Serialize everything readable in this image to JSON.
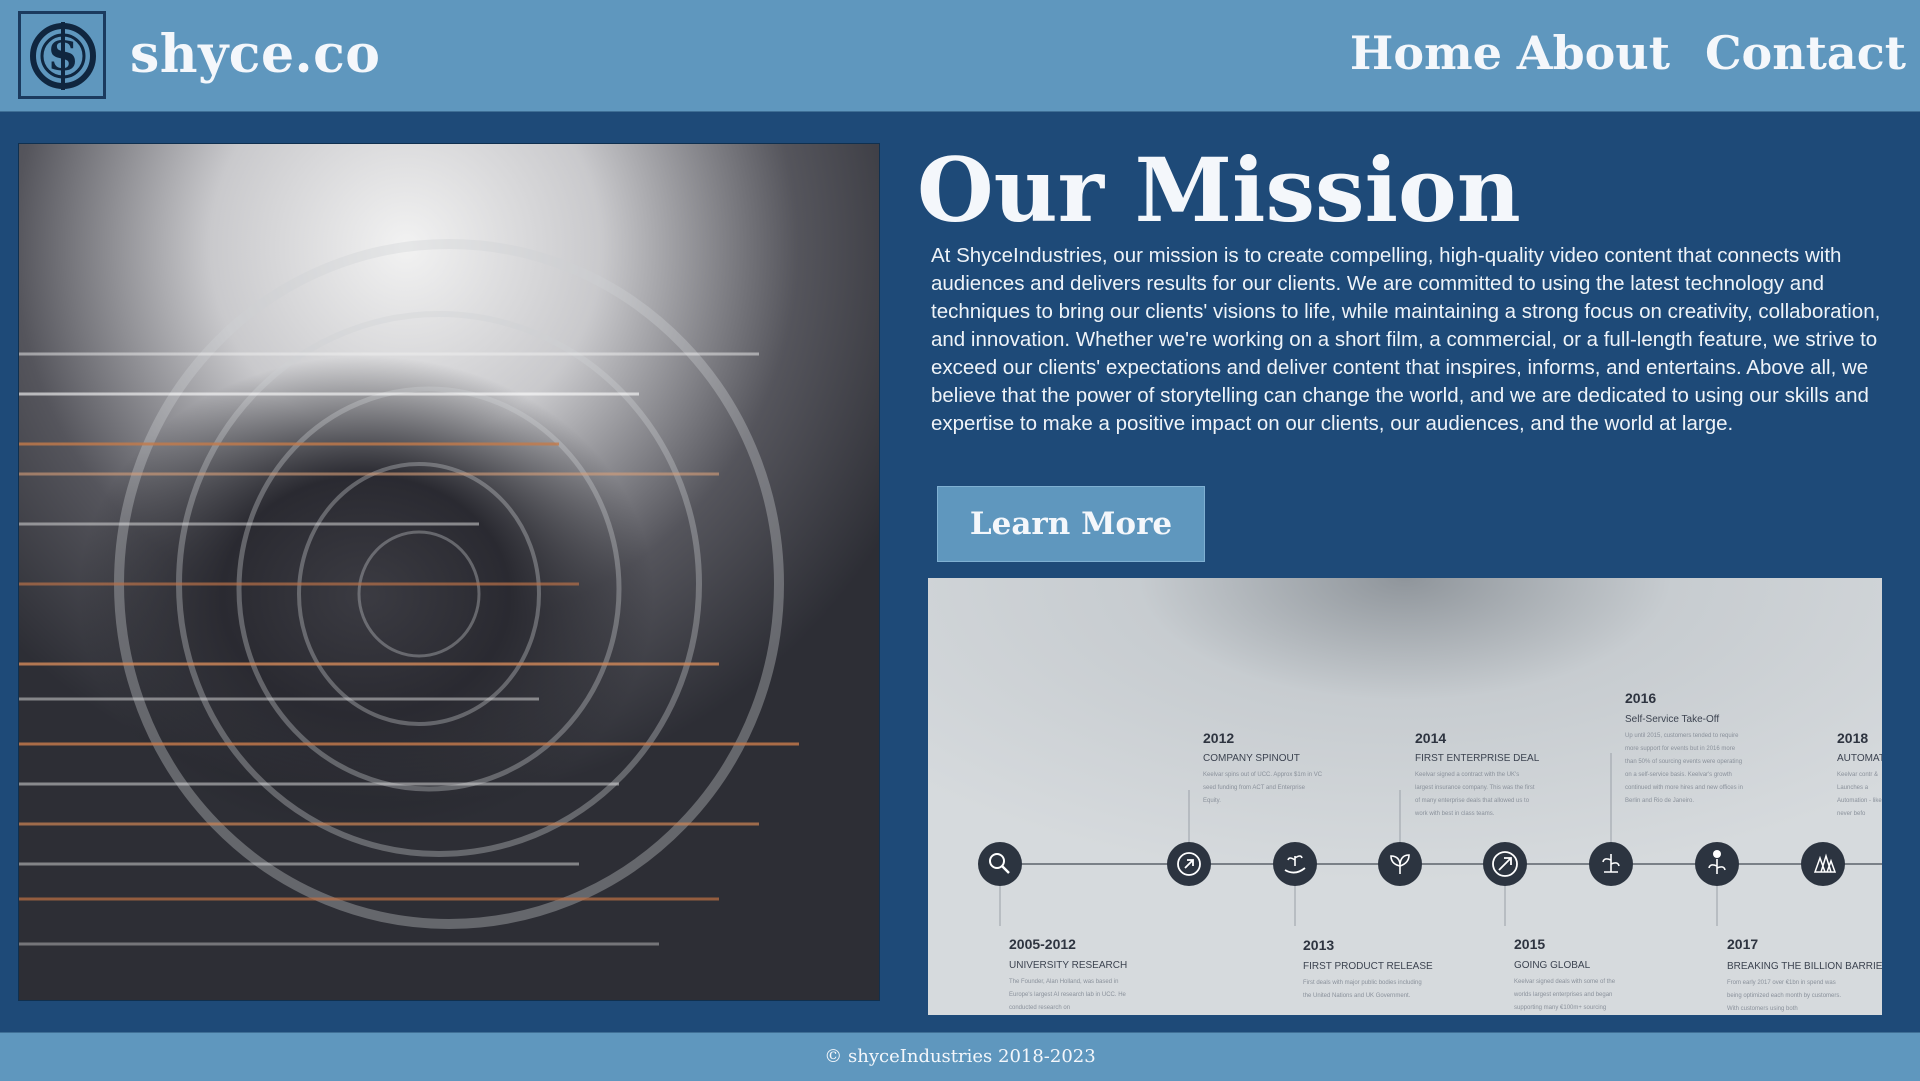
{
  "brand": {
    "name": "shyce.co",
    "logo_icon": "shyce-s-logo-icon"
  },
  "nav": {
    "items": [
      "Home",
      "About",
      "Contact"
    ]
  },
  "mission": {
    "title": "Our Mission",
    "body": "At ShyceIndustries, our mission is to create compelling, high-quality video content that connects with audiences and delivers results for our clients. We are committed to using the latest technology and techniques to bring our clients' visions to life, while maintaining a strong focus on creativity, collaboration, and innovation. Whether we're working on a short film, a commercial, or a full-length feature, we strive to exceed our clients' expectations and deliver content that inspires, informs, and entertains. Above all, we believe that the power of storytelling can change the world, and we are dedicated to using our skills and expertise to make a positive impact on our clients, our audiences, and the world at large.",
    "button_label": "Learn More"
  },
  "timeline": {
    "top_milestones": [
      {
        "year": "2012",
        "heading": "COMPANY SPINOUT",
        "desc": "Keelvar spins out of UCC. Approx $1m in VC seed funding from ACT and Enterprise Equity."
      },
      {
        "year": "2014",
        "heading": "FIRST ENTERPRISE DEAL",
        "desc": "Keelvar signed a contract with the UK's largest insurance company. This was the first of many enterprise deals that allowed us to work with best in class teams."
      },
      {
        "year": "2016",
        "heading": "Self-Service Take-Off",
        "desc": "Up until 2015, customers tended to require more support for events but in 2016 more than 50% of sourcing events were operating on a self-service basis. Keelvar's growth continued with more hires and new offices in Berlin and Rio de Janeiro."
      },
      {
        "year": "2018",
        "heading": "AUTOMAT",
        "desc": "Keelvar contr & Launches a Automation - like never befo"
      }
    ],
    "bottom_milestones": [
      {
        "year": "2005-2012",
        "heading": "UNIVERSITY RESEARCH",
        "desc": "The Founder, Alan Holland, was based in Europe's largest AI research lab in UCC. He conducted research on"
      },
      {
        "year": "2013",
        "heading": "FIRST PRODUCT RELEASE",
        "desc": "First deals with major public bodies including the United Nations and UK Government."
      },
      {
        "year": "2015",
        "heading": "GOING GLOBAL",
        "desc": "Keelvar signed deals with some of the worlds largest enterprises and began supporting many €100m+ sourcing"
      },
      {
        "year": "2017",
        "heading": "BREAKING THE BILLION BARRIER",
        "desc": "From early 2017 over €1bn in spend was being optimized each month by customers. With customers using both"
      }
    ],
    "icons": [
      "magnifier-icon",
      "arrow-circle-icon",
      "hand-plant-icon",
      "sprout-icon",
      "arrow-up-right-icon",
      "plant-pot-icon",
      "plant-bulb-icon",
      "trees-icon"
    ]
  },
  "footer": {
    "text": "© shyceIndustries 2018-2023"
  },
  "colors": {
    "header": "#5f97be",
    "body": "#1e4a78",
    "text": "#f4f7fb",
    "timeline_bg": "#d6dadd",
    "timeline_dot": "#2c3440"
  }
}
